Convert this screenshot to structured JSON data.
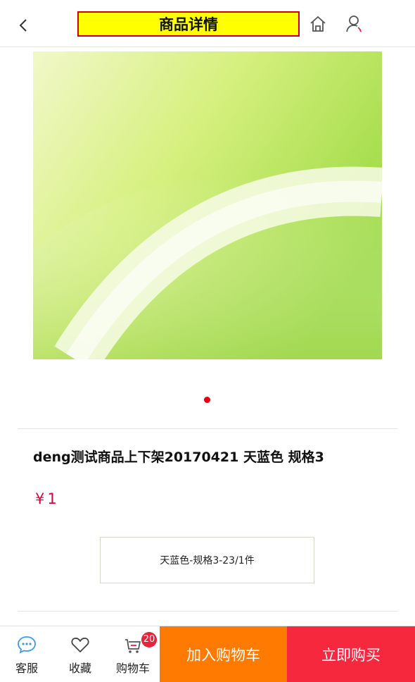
{
  "header": {
    "title": "商品详情",
    "back_icon": "chevron-left-icon",
    "home_icon": "home-icon",
    "user_icon": "user-icon"
  },
  "product": {
    "name": "deng测试商品上下架20170421 天蓝色 规格3",
    "currency": "¥",
    "price": "1",
    "spec": "天蓝色-规格3-23/1件",
    "carousel": {
      "total": 1,
      "active": 1
    }
  },
  "bottom_bar": {
    "service_label": "客服",
    "favorite_label": "收藏",
    "cart_label": "购物车",
    "cart_count": "20",
    "add_to_cart_label": "加入购物车",
    "buy_now_label": "立即购买"
  },
  "colors": {
    "accent_red": "#e60012",
    "price_red": "#e0003c",
    "add_cart_orange": "#ff7a00",
    "buy_now_red": "#f5283e",
    "title_highlight": "#ffff00"
  }
}
